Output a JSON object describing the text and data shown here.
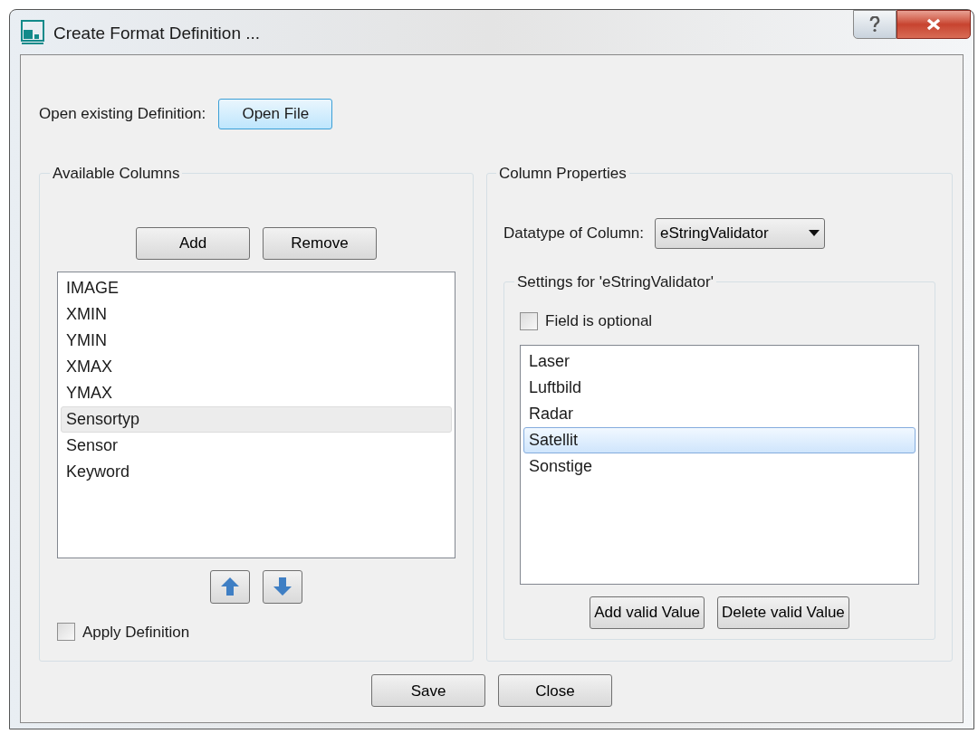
{
  "window": {
    "title": "Create Format Definition ..."
  },
  "open_row": {
    "label": "Open existing Definition:",
    "button": "Open File"
  },
  "available_columns": {
    "title": "Available Columns",
    "buttons": [
      "Add",
      "Remove"
    ],
    "items": [
      {
        "label": "IMAGE",
        "selected": false
      },
      {
        "label": "XMIN",
        "selected": false
      },
      {
        "label": "YMIN",
        "selected": false
      },
      {
        "label": "XMAX",
        "selected": false
      },
      {
        "label": "YMAX",
        "selected": false
      },
      {
        "label": "Sensortyp",
        "selected": true
      },
      {
        "label": "Sensor",
        "selected": false
      },
      {
        "label": "Keyword",
        "selected": false
      }
    ],
    "apply": {
      "label": "Apply Definition",
      "checked": false
    }
  },
  "column_properties": {
    "title": "Column Properties",
    "datatype_label": "Datatype of Column:",
    "datatype_value": "eStringValidator",
    "settings": {
      "title": "Settings for 'eStringValidator'",
      "optional": {
        "label": "Field is optional",
        "checked": false
      },
      "values": [
        {
          "label": "Laser",
          "selected": false
        },
        {
          "label": "Luftbild",
          "selected": false
        },
        {
          "label": "Radar",
          "selected": false
        },
        {
          "label": "Satellit",
          "selected": true
        },
        {
          "label": "Sonstige",
          "selected": false
        }
      ],
      "buttons": [
        "Add valid Value",
        "Delete valid Value"
      ]
    }
  },
  "footer_buttons": [
    "Save",
    "Close"
  ]
}
